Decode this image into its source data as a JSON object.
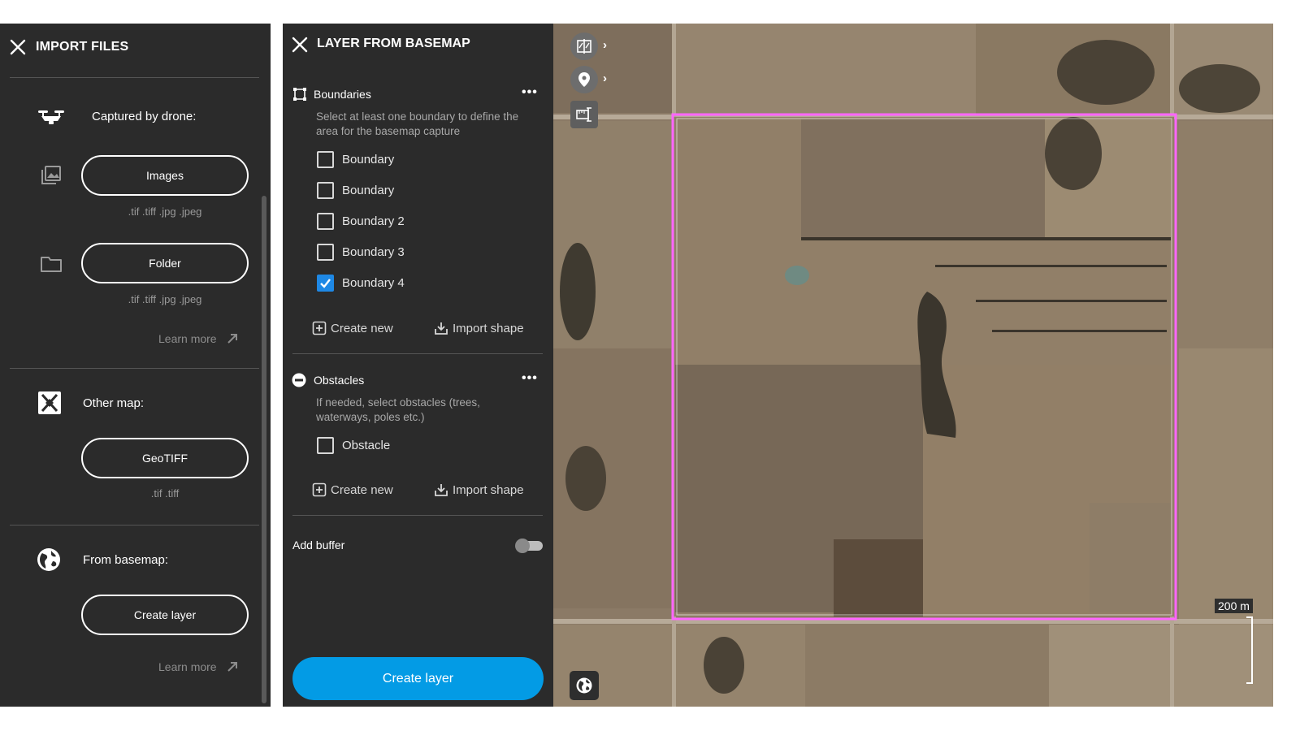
{
  "import_panel": {
    "title": "IMPORT FILES",
    "drone_section": {
      "label": "Captured by drone:",
      "images_button": "Images",
      "images_ext": ".tif .tiff .jpg .jpeg",
      "folder_button": "Folder",
      "folder_ext": ".tif .tiff .jpg .jpeg",
      "learn_more": "Learn more"
    },
    "other_map_section": {
      "label": "Other map:",
      "geotiff_button": "GeoTIFF",
      "geotiff_ext": ".tif .tiff"
    },
    "basemap_section": {
      "label": "From basemap:",
      "create_button": "Create layer",
      "learn_more": "Learn more"
    }
  },
  "basemap_panel": {
    "title": "LAYER FROM BASEMAP",
    "boundaries": {
      "title": "Boundaries",
      "description": "Select at least one boundary to define the area for the basemap capture",
      "items": [
        {
          "label": "Boundary",
          "checked": false
        },
        {
          "label": "Boundary",
          "checked": false
        },
        {
          "label": "Boundary 2",
          "checked": false
        },
        {
          "label": "Boundary 3",
          "checked": false
        },
        {
          "label": "Boundary 4",
          "checked": true
        }
      ],
      "create_new": "Create new",
      "import_shape": "Import shape"
    },
    "obstacles": {
      "title": "Obstacles",
      "description": "If needed, select obstacles (trees, waterways, poles etc.)",
      "items": [
        {
          "label": "Obstacle",
          "checked": false
        }
      ],
      "create_new": "Create new",
      "import_shape": "Import shape"
    },
    "add_buffer": {
      "label": "Add buffer",
      "enabled": false
    },
    "create_button": "Create layer"
  },
  "map": {
    "scale_label": "200 m",
    "boundary_color": "#ff66ff",
    "accent_color": "#039be5"
  }
}
